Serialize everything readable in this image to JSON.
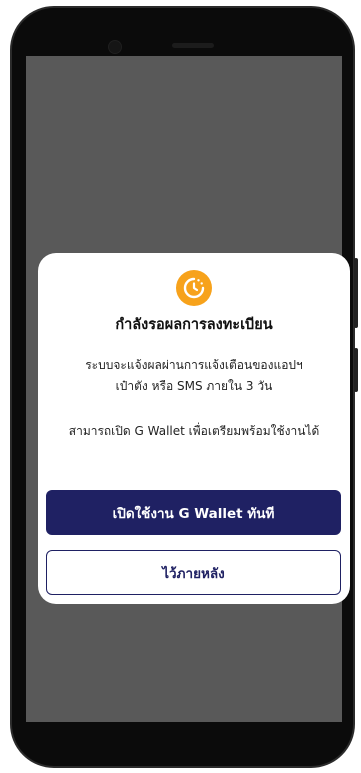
{
  "dialog": {
    "icon": "clock-history-icon",
    "accent_color": "#f7a21b",
    "title": "กำลังรอผลการลงทะเบียน",
    "message_line1": "ระบบจะแจ้งผลผ่านการแจ้งเตือนของแอปฯ",
    "message_line2": "เป๋าตัง หรือ SMS ภายใน 3 วัน",
    "note": "สามารถเปิด G Wallet เพื่อเตรียมพร้อมใช้งานได้",
    "primary_button": "เปิดใช้งาน G Wallet ทันที",
    "secondary_button": "ไว้ภายหลัง",
    "primary_color": "#1f2163"
  }
}
